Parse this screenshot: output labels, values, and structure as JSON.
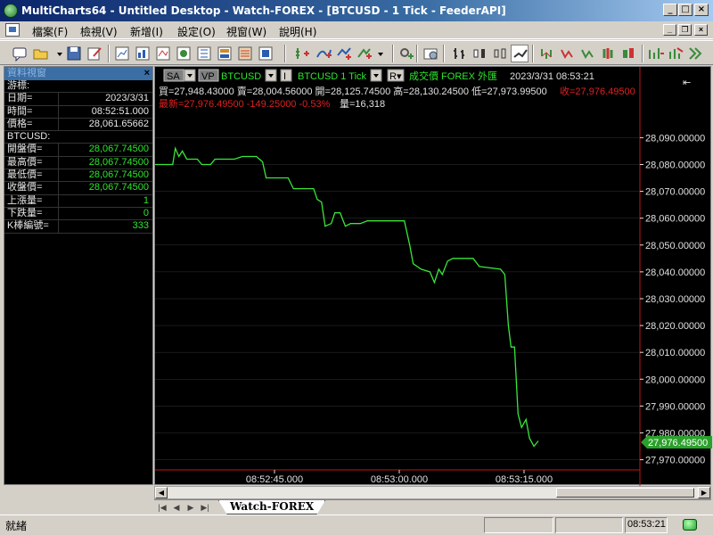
{
  "window": {
    "title": "MultiCharts64 - Untitled Desktop - Watch-FOREX - [BTCUSD - 1 Tick - FeederAPI]"
  },
  "menu": [
    "檔案(F)",
    "檢視(V)",
    "新增(I)",
    "設定(O)",
    "視窗(W)",
    "說明(H)"
  ],
  "toolbar": {
    "icons": [
      "comment-icon",
      "open-folder-icon",
      "save-icon",
      "edit-icon",
      "chart-new-icon",
      "chart-icon",
      "chart-icon",
      "chart-icon",
      "chart-icon",
      "chart-icon",
      "chart-icon",
      "add-study-icon",
      "drawing-icon",
      "drawing-icon",
      "indicator-icon",
      "settings-icon",
      "bar-type-icon",
      "bar-type-icon",
      "bar-type-icon",
      "bar-type-icon",
      "line-type-icon",
      "bar-type-icon",
      "bar-type-icon",
      "bar-type-icon",
      "bar-type-icon",
      "bar-type-icon",
      "zoom-icon",
      "zoom-icon",
      "zoom-icon",
      "zoom-icon",
      "zoom-icon"
    ]
  },
  "sidebar": {
    "header": "資料視窗",
    "rows": [
      {
        "label": "游標:",
        "value": "",
        "header": true
      },
      {
        "label": "日期=",
        "value": "2023/3/31",
        "color": "white"
      },
      {
        "label": "時間=",
        "value": "08:52:51.000",
        "color": "white"
      },
      {
        "label": "價格=",
        "value": "28,061.65662",
        "color": "white"
      },
      {
        "label": "BTCUSD:",
        "value": "",
        "header": true
      },
      {
        "label": "開盤價=",
        "value": "28,067.74500",
        "color": "green"
      },
      {
        "label": "最高價=",
        "value": "28,067.74500",
        "color": "green"
      },
      {
        "label": "最低價=",
        "value": "28,067.74500",
        "color": "green"
      },
      {
        "label": "收盤價=",
        "value": "28,067.74500",
        "color": "green"
      },
      {
        "label": "上漲量=",
        "value": "1",
        "color": "green"
      },
      {
        "label": "下跌量=",
        "value": "0",
        "color": "green"
      },
      {
        "label": "K棒編號=",
        "value": "333",
        "color": "green"
      }
    ]
  },
  "chart_header": {
    "sa_label": "SA",
    "vp_label": "VP",
    "symbol": "BTCUSD",
    "symbol_full": "BTCUSD  1 Tick",
    "price_type": "成交價  FOREX  外匯",
    "datetime": "2023/3/31  08:53:21",
    "ohlc_line": "買=27,948.43000  賣=28,004.56000  開=28,125.74500  高=28,130.24500  低=27,973.99500",
    "close_text": "收=27,976.49500",
    "last_line": "最新=27,976.49500  -149.25000  -0.53%",
    "volume_text": "量=16,318"
  },
  "colors": {
    "line": "#39e63a",
    "text_green": "#2ee62e",
    "text_red": "#e02020",
    "axis_text": "#e0e0e0",
    "grid": "#333333",
    "last_price_bg": "#2aa02a"
  },
  "chart_data": {
    "type": "line",
    "title": "BTCUSD  1 Tick",
    "x_ticks": [
      "08:52:45.000",
      "08:53:00.000",
      "08:53:15.000"
    ],
    "y_ticks": [
      28090,
      28080,
      28070,
      28060,
      28050,
      28040,
      28030,
      28020,
      28010,
      28000,
      27990,
      27980,
      27970
    ],
    "y_tick_labels": [
      "28,090.00000",
      "28,080.00000",
      "28,070.00000",
      "28,060.00000",
      "28,050.00000",
      "28,040.00000",
      "28,030.00000",
      "28,020.00000",
      "28,010.00000",
      "28,000.00000",
      "27,990.00000",
      "27,980.00000",
      "27,970.00000"
    ],
    "ylim": [
      27966.2,
      28099.1
    ],
    "last_price": 27976.495,
    "last_price_label": "27,976.49500",
    "grid": true,
    "series": [
      {
        "values": [
          [
            0,
            28080
          ],
          [
            20,
            28080
          ],
          [
            23,
            28086
          ],
          [
            27,
            28083
          ],
          [
            31,
            28085
          ],
          [
            36,
            28082
          ],
          [
            48,
            28082
          ],
          [
            53,
            28080
          ],
          [
            63,
            28080
          ],
          [
            68,
            28082
          ],
          [
            90,
            28082
          ],
          [
            99,
            28083
          ],
          [
            115,
            28083
          ],
          [
            122,
            28081
          ],
          [
            126,
            28075
          ],
          [
            151,
            28075
          ],
          [
            157,
            28071
          ],
          [
            180,
            28071
          ],
          [
            184,
            28067
          ],
          [
            189,
            28066
          ],
          [
            193,
            28057
          ],
          [
            200,
            28058
          ],
          [
            204,
            28062
          ],
          [
            210,
            28062
          ],
          [
            216,
            28057
          ],
          [
            222,
            28058
          ],
          [
            233,
            28058
          ],
          [
            241,
            28059
          ],
          [
            256,
            28059
          ],
          [
            283,
            28059
          ],
          [
            289,
            28050
          ],
          [
            293,
            28043
          ],
          [
            302,
            28041
          ],
          [
            312,
            28040
          ],
          [
            317,
            28036
          ],
          [
            322,
            28041
          ],
          [
            326,
            28039
          ],
          [
            332,
            28044
          ],
          [
            338,
            28045
          ],
          [
            343,
            28045
          ],
          [
            361,
            28045
          ],
          [
            368,
            28042
          ],
          [
            392,
            28041
          ],
          [
            397,
            28039
          ],
          [
            401,
            28020
          ],
          [
            404,
            28012
          ],
          [
            408,
            28012
          ],
          [
            412,
            27987
          ],
          [
            416,
            27982
          ],
          [
            421,
            27985
          ],
          [
            425,
            27978
          ],
          [
            430,
            27975
          ],
          [
            435,
            27977
          ]
        ]
      }
    ]
  }
}
